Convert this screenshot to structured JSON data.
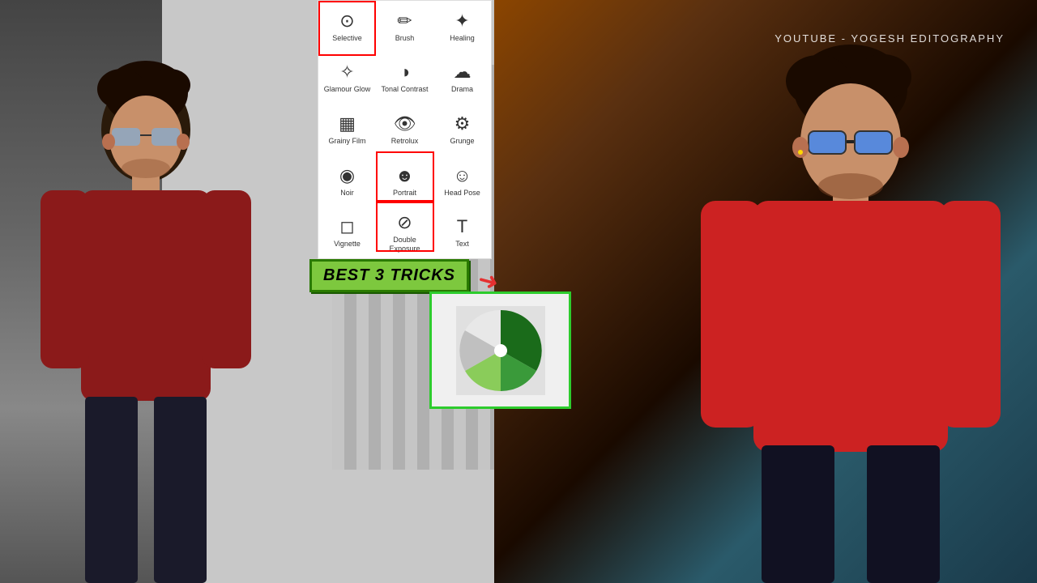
{
  "watermark": "YOUTUBE - YOGESH EDITOGRAPHY",
  "banner": "BEST 3 TRICKS",
  "tools": [
    {
      "id": "selective",
      "label": "Selective",
      "icon": "⊙"
    },
    {
      "id": "brush",
      "label": "Brush",
      "icon": "✏"
    },
    {
      "id": "healing",
      "label": "Healing",
      "icon": "✚"
    },
    {
      "id": "glamour-glow",
      "label": "Glamour Glow",
      "icon": "✦"
    },
    {
      "id": "tonal-contrast",
      "label": "Tonal Contrast",
      "icon": "◑"
    },
    {
      "id": "drama",
      "label": "Drama",
      "icon": "☁"
    },
    {
      "id": "grainy-film",
      "label": "Grainy Film",
      "icon": "▦"
    },
    {
      "id": "retrolux",
      "label": "Retrolux",
      "icon": "👁"
    },
    {
      "id": "grunge",
      "label": "Grunge",
      "icon": "⚙"
    },
    {
      "id": "noir",
      "label": "Noir",
      "icon": "◉"
    },
    {
      "id": "portrait",
      "label": "Portrait",
      "icon": "☻"
    },
    {
      "id": "head-pose",
      "label": "Head Pose",
      "icon": "☺"
    },
    {
      "id": "vignette",
      "label": "Vignette",
      "icon": "◻"
    },
    {
      "id": "double-exposure",
      "label": "Double Exposure",
      "icon": "⊘"
    },
    {
      "id": "text",
      "label": "Text",
      "icon": "T"
    }
  ]
}
